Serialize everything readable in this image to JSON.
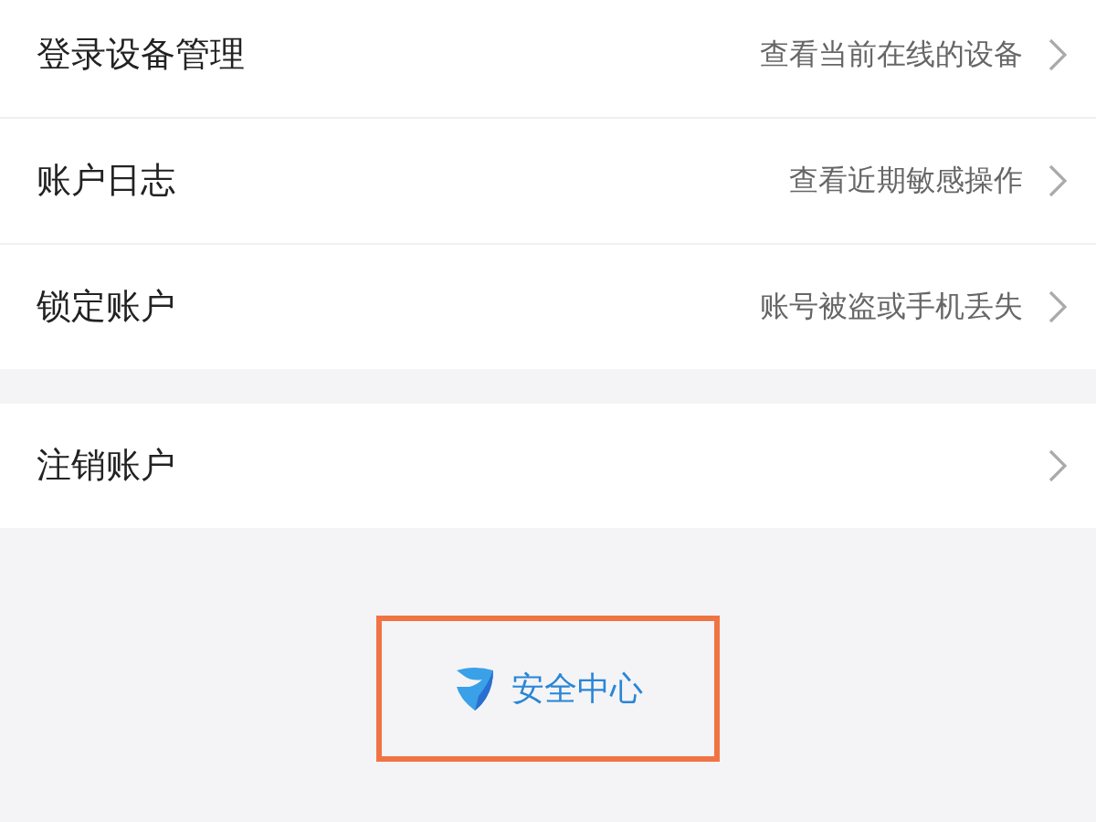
{
  "groups": [
    {
      "items": [
        {
          "label": "登录设备管理",
          "hint": "查看当前在线的设备"
        },
        {
          "label": "账户日志",
          "hint": "查看近期敏感操作"
        },
        {
          "label": "锁定账户",
          "hint": "账号被盗或手机丢失"
        }
      ]
    },
    {
      "items": [
        {
          "label": "注销账户"
        }
      ]
    }
  ],
  "footer": {
    "label": "安全中心",
    "highlighted": true
  }
}
